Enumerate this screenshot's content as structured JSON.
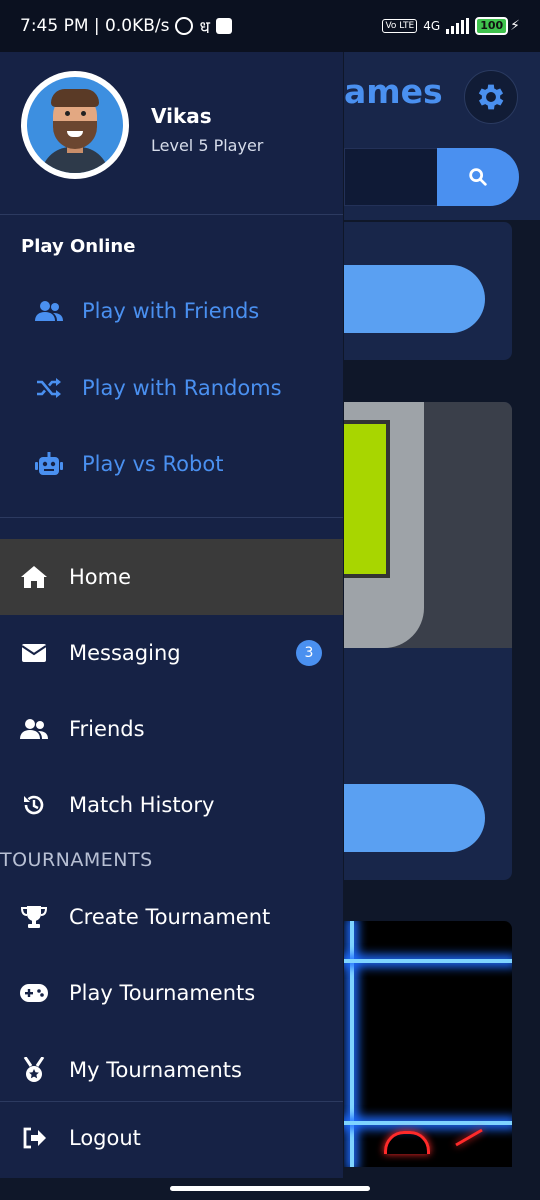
{
  "status_bar": {
    "time_speed": "7:45 PM | 0.0KB/s",
    "extra_glyph": "ध",
    "network": "4G",
    "volte": "Vo LTE",
    "battery": "100"
  },
  "background": {
    "title_fragment": "ames"
  },
  "profile": {
    "name": "Vikas",
    "level": "Level 5 Player"
  },
  "play_online": {
    "heading": "Play Online",
    "items": [
      {
        "label": "Play with Friends",
        "icon": "users-icon"
      },
      {
        "label": "Play with Randoms",
        "icon": "shuffle-icon"
      },
      {
        "label": "Play vs Robot",
        "icon": "robot-icon"
      }
    ]
  },
  "nav": {
    "items": [
      {
        "label": "Home",
        "icon": "home-icon",
        "active": true
      },
      {
        "label": "Messaging",
        "icon": "envelope-icon",
        "badge": "3"
      },
      {
        "label": "Friends",
        "icon": "users-icon"
      },
      {
        "label": "Match History",
        "icon": "history-icon"
      }
    ]
  },
  "tournaments": {
    "heading": "TOURNAMENTS",
    "items": [
      {
        "label": "Create Tournament",
        "icon": "trophy-icon"
      },
      {
        "label": "Play Tournaments",
        "icon": "gamepad-icon"
      },
      {
        "label": "My Tournaments",
        "icon": "medal-icon"
      }
    ]
  },
  "logout": {
    "label": "Logout",
    "icon": "logout-icon"
  },
  "colors": {
    "accent": "#4a90f0",
    "drawer_bg": "#162245",
    "active_bg": "#3a3a3a"
  }
}
